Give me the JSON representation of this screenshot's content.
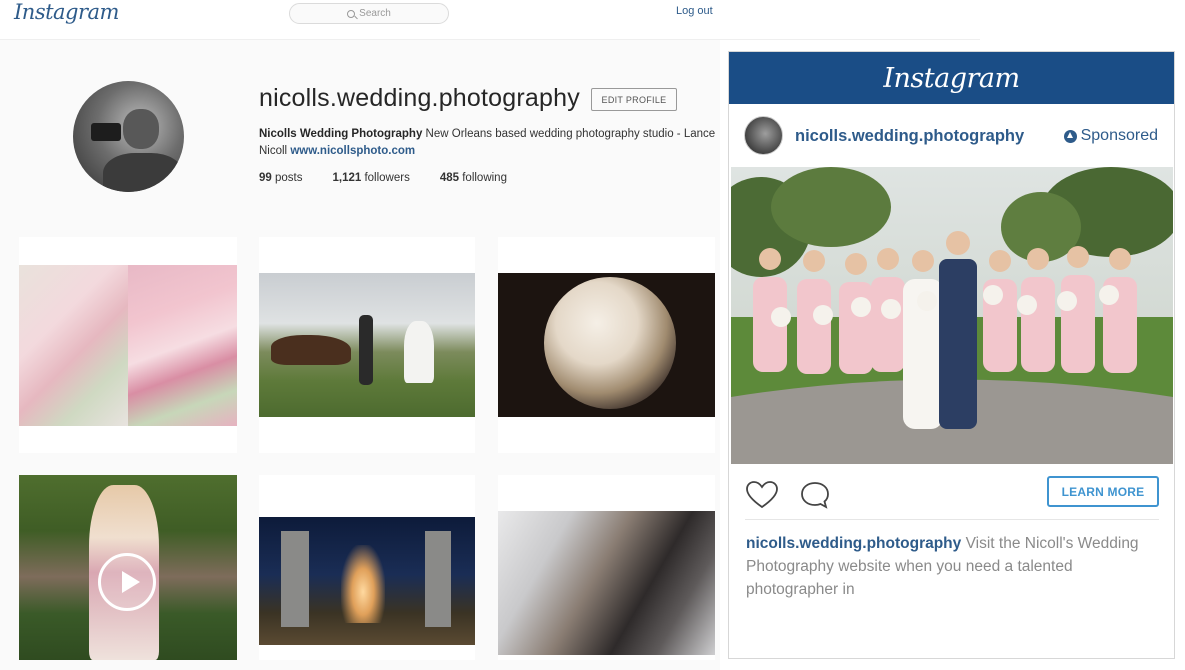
{
  "topbar": {
    "logo": "Instagram",
    "search_placeholder": "Search",
    "search_icon": "search-icon",
    "logout": "Log out"
  },
  "profile": {
    "username": "nicolls.wedding.photography",
    "edit_button": "EDIT PROFILE",
    "bio_name": "Nicolls Wedding Photography",
    "bio_text": " New Orleans based wedding photography studio - Lance Nicoll ",
    "bio_link": "www.nicollsphoto.com",
    "stats": {
      "posts_count": "99",
      "posts_label": " posts",
      "followers_count": "1,121",
      "followers_label": " followers",
      "following_count": "485",
      "following_label": " following"
    }
  },
  "grid": {
    "video_icon": "play-icon"
  },
  "ad": {
    "header_logo": "Instagram",
    "username": "nicolls.wedding.photography",
    "sponsored": "Sponsored",
    "sponsored_icon": "sponsored-icon",
    "like_icon": "heart-icon",
    "comment_icon": "comment-icon",
    "learn_more": "LEARN MORE",
    "caption_user": "nicolls.wedding.photography",
    "caption_text": " Visit the Nicoll's Wedding Photography website when you need a talented photographer in"
  },
  "colors": {
    "brand_blue": "#1a4d86",
    "link_blue": "#2e5b8a",
    "button_blue": "#3f94d0"
  }
}
